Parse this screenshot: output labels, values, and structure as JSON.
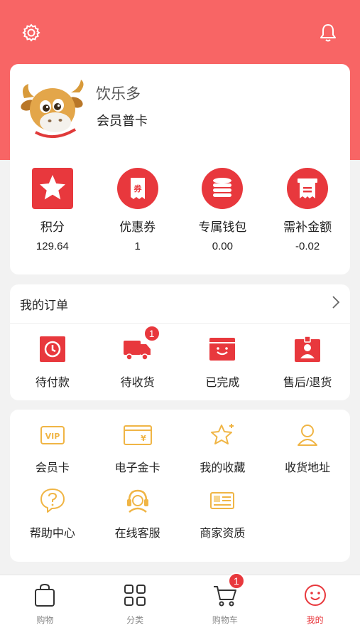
{
  "header": {
    "settings_icon": "gear-icon",
    "notification_icon": "bell-icon"
  },
  "profile": {
    "name": "饮乐多",
    "member_level": "会员普卡",
    "avatar": "cow-mascot-avatar"
  },
  "stats": [
    {
      "label": "积分",
      "value": "129.64",
      "icon": "star-icon"
    },
    {
      "label": "优惠券",
      "value": "1",
      "icon": "coupon-icon"
    },
    {
      "label": "专属钱包",
      "value": "0.00",
      "icon": "wallet-coins-icon"
    },
    {
      "label": "需补金额",
      "value": "-0.02",
      "icon": "receipt-icon"
    }
  ],
  "orders": {
    "title": "我的订单",
    "items": [
      {
        "label": "待付款",
        "icon": "clock-icon"
      },
      {
        "label": "待收货",
        "icon": "truck-icon",
        "badge": "1"
      },
      {
        "label": "已完成",
        "icon": "smile-box-icon"
      },
      {
        "label": "售后/退货",
        "icon": "service-badge-icon"
      }
    ]
  },
  "services": [
    {
      "label": "会员卡",
      "icon": "vip-card-icon"
    },
    {
      "label": "电子金卡",
      "icon": "gold-card-icon"
    },
    {
      "label": "我的收藏",
      "icon": "star-favorite-icon"
    },
    {
      "label": "收货地址",
      "icon": "user-location-icon"
    },
    {
      "label": "帮助中心",
      "icon": "help-icon"
    },
    {
      "label": "在线客服",
      "icon": "headset-icon"
    },
    {
      "label": "商家资质",
      "icon": "license-icon"
    }
  ],
  "tabbar": [
    {
      "label": "购物",
      "icon": "shopping-bag-icon"
    },
    {
      "label": "分类",
      "icon": "grid-icon"
    },
    {
      "label": "购物车",
      "icon": "cart-icon",
      "badge": "1"
    },
    {
      "label": "我的",
      "icon": "smile-face-icon",
      "active": true
    }
  ],
  "colors": {
    "header_bg": "#f86565",
    "accent": "#e8383d",
    "service_icon": "#f0b545"
  }
}
